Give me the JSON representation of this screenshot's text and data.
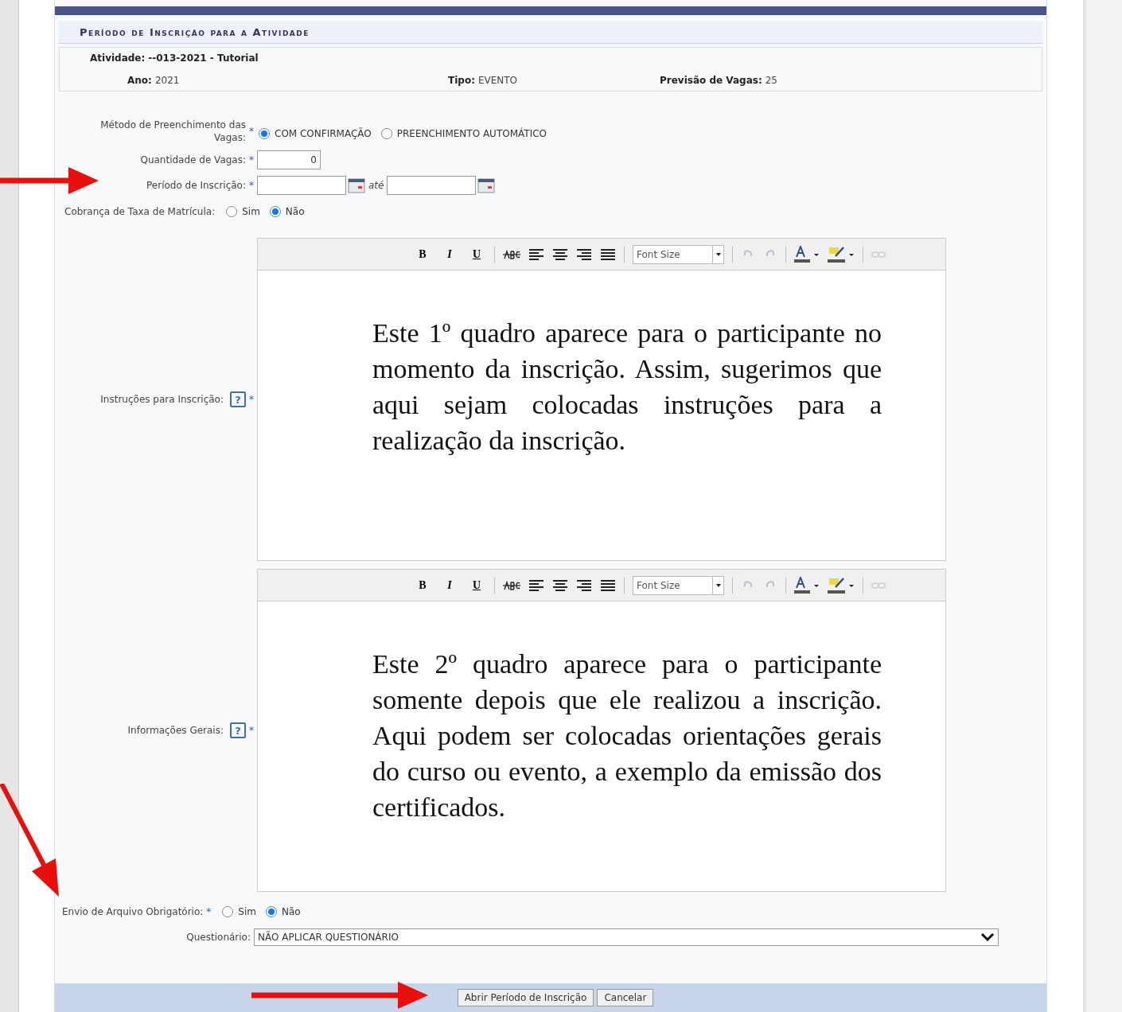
{
  "section_title": "Período de Inscrição para a Atividade",
  "info": {
    "atividade_label": "Atividade:",
    "atividade": "--013-2021 - Tutorial",
    "fields": [
      {
        "label": "Ano:",
        "value": "2021"
      },
      {
        "label": "Tipo:",
        "value": "EVENTO"
      },
      {
        "label": "Previsão de Vagas:",
        "value": "25"
      }
    ]
  },
  "metodo": {
    "label_lines": [
      "Método de Preenchimento das",
      "Vagas:"
    ],
    "options": [
      {
        "label": "COM CONFIRMAÇÃO",
        "selected": true
      },
      {
        "label": "PREENCHIMENTO AUTOMÁTICO",
        "selected": false
      }
    ]
  },
  "quantidade": {
    "label": "Quantidade de Vagas:",
    "value": "0"
  },
  "periodo": {
    "label": "Período de Inscrição:",
    "separator": "até"
  },
  "cobranca": {
    "label": "Cobrança de Taxa de Matrícula:",
    "options": [
      {
        "label": "Sim",
        "selected": false
      },
      {
        "label": "Não",
        "selected": true
      }
    ]
  },
  "editors": [
    {
      "label": "Instruções para Inscrição:",
      "help": "?",
      "toolbar": {
        "format_buttons": [
          "B",
          "I",
          "U"
        ],
        "font_size": "Font Size"
      },
      "text": "Este  1º quadro aparece para o participante no momento da inscrição. Assim, sugerimos  que aqui sejam colocadas instruções para a realização da inscrição."
    },
    {
      "label": "Informações Gerais:",
      "help": "?",
      "toolbar": {
        "format_buttons": [
          "B",
          "I",
          "U"
        ],
        "font_size": "Font Size"
      },
      "text": "Este 2º quadro aparece para o participante somente depois que ele realizou a inscrição. Aqui podem ser colocadas orientações gerais do curso ou evento, a exemplo da emissão dos certificados."
    }
  ],
  "envio": {
    "label": "Envio de Arquivo Obrigatório:",
    "options": [
      {
        "label": "Sim",
        "selected": false
      },
      {
        "label": "Não",
        "selected": true
      }
    ]
  },
  "questionario": {
    "label": "Questionário:",
    "value": "NÃO APLICAR QUESTIONÁRIO"
  },
  "buttons": [
    "Abrir Período de Inscrição",
    "Cancelar"
  ],
  "required_mark": "*"
}
